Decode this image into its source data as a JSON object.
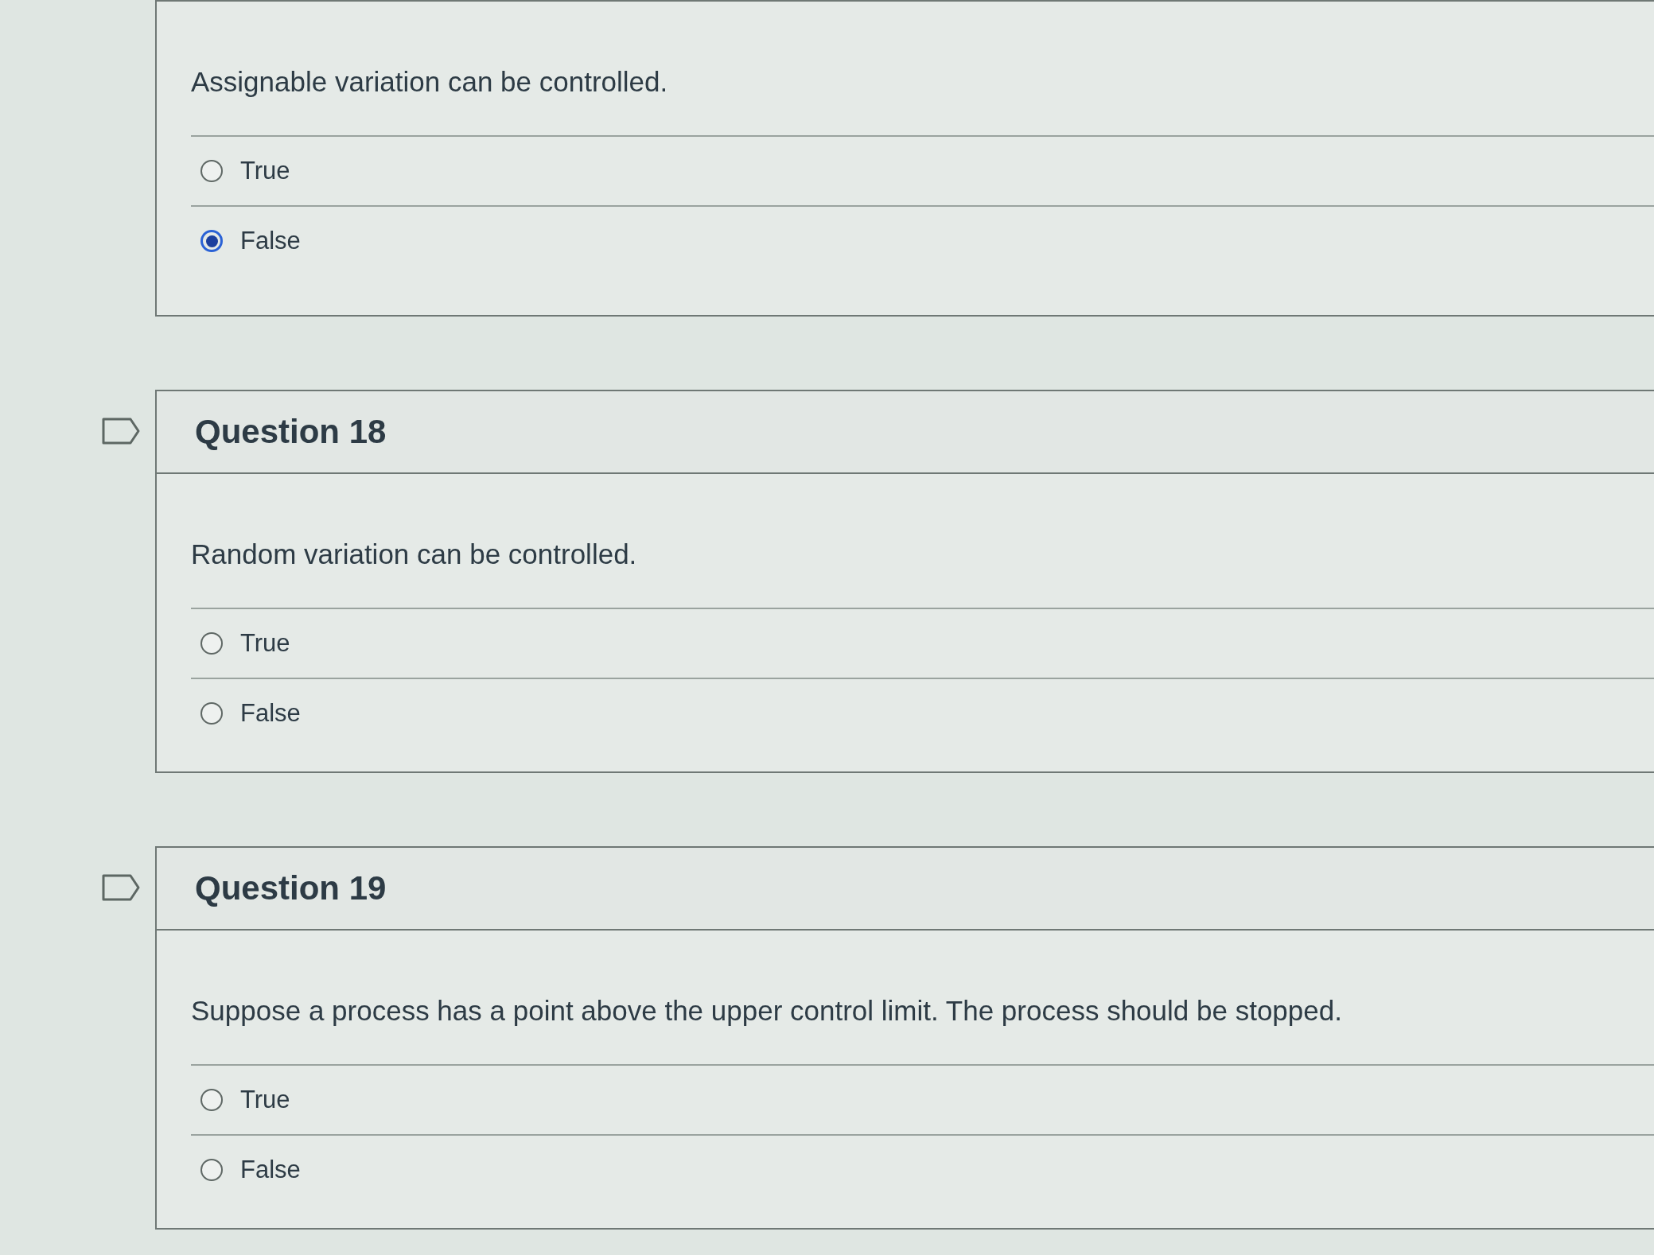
{
  "questions": [
    {
      "prompt": "Assignable variation can be controlled.",
      "options": [
        {
          "label": "True",
          "selected": false
        },
        {
          "label": "False",
          "selected": true
        }
      ]
    },
    {
      "title": "Question 18",
      "prompt": "Random variation can be controlled.",
      "options": [
        {
          "label": "True",
          "selected": false
        },
        {
          "label": "False",
          "selected": false
        }
      ]
    },
    {
      "title": "Question 19",
      "prompt": "Suppose a process has a point above the upper control limit. The process should be stopped.",
      "options": [
        {
          "label": "True",
          "selected": false
        },
        {
          "label": "False",
          "selected": false
        }
      ]
    }
  ]
}
